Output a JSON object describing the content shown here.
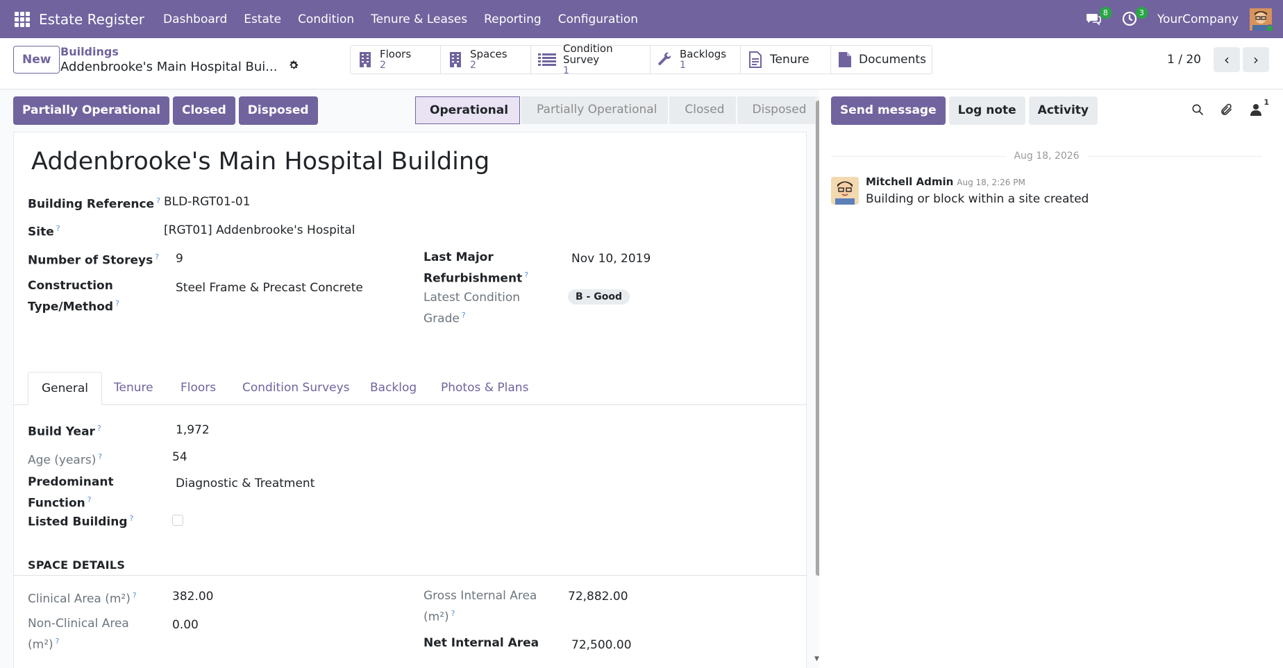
{
  "navbar": {
    "app_title": "Estate Register",
    "menu": [
      "Dashboard",
      "Estate",
      "Condition",
      "Tenure & Leases",
      "Reporting",
      "Configuration"
    ],
    "messages_count": "8",
    "activities_count": "3",
    "company": "YourCompany"
  },
  "control": {
    "new_label": "New",
    "breadcrumb_parent": "Buildings",
    "breadcrumb_current": "Addenbrooke's Main Hospital Bui...",
    "smart_buttons": [
      {
        "label": "Floors",
        "value": "2",
        "icon": "building-icon"
      },
      {
        "label": "Spaces",
        "value": "2",
        "icon": "building-icon"
      },
      {
        "label": "Condition Survey",
        "value": "1",
        "icon": "list-icon"
      },
      {
        "label": "Backlogs",
        "value": "1",
        "icon": "wrench-icon"
      },
      {
        "label": "Tenure",
        "icon": "document-icon"
      },
      {
        "label": "Documents",
        "icon": "file-icon"
      }
    ],
    "pager": "1 / 20"
  },
  "status_actions": [
    "Partially Operational",
    "Closed",
    "Disposed"
  ],
  "statusbar": {
    "stages": [
      "Operational",
      "Partially Operational",
      "Closed",
      "Disposed"
    ],
    "active": "Operational"
  },
  "form": {
    "title": "Addenbrooke's Main Hospital Building",
    "fields": {
      "building_reference": {
        "label": "Building Reference",
        "value": "BLD-RGT01-01"
      },
      "site": {
        "label": "Site",
        "value": "[RGT01] Addenbrooke's Hospital"
      },
      "storeys": {
        "label": "Number of Storeys",
        "value": "9"
      },
      "construction_l1": "Construction",
      "construction_l2": "Type/Method",
      "construction_value": "Steel Frame & Precast Concrete",
      "refurb_l1": "Last Major",
      "refurb_l2": "Refurbishment",
      "refurb_value": "Nov 10, 2019",
      "grade_l1": "Latest Condition",
      "grade_l2": "Grade",
      "grade_value": "B - Good"
    },
    "tabs": [
      "General",
      "Tenure",
      "Floors",
      "Condition Surveys",
      "Backlog",
      "Photos & Plans"
    ],
    "general": {
      "build_year": {
        "label": "Build Year",
        "value": "1,972"
      },
      "age": {
        "label": "Age (years)",
        "value": "54"
      },
      "function_l1": "Predominant",
      "function_l2": "Function",
      "function_value": "Diagnostic & Treatment",
      "listed": {
        "label": "Listed Building"
      }
    },
    "space_details": {
      "title": "SPACE DETAILS",
      "clinical": {
        "label": "Clinical Area (m²)",
        "value": "382.00"
      },
      "nonclinical_l1": "Non-Clinical Area",
      "nonclinical_l2": "(m²)",
      "nonclinical_value": "0.00",
      "gia_l1": "Gross Internal Area",
      "gia_l2": "(m²)",
      "gia_value": "72,882.00",
      "nia_label": "Net Internal Area",
      "nia_value": "72,500.00"
    }
  },
  "chatter": {
    "send_message": "Send message",
    "log_note": "Log note",
    "activity": "Activity",
    "followers_count": "1",
    "date": "Aug 18, 2026",
    "message": {
      "author": "Mitchell Admin",
      "time": "Aug 18, 2:26 PM",
      "body": "Building or block within a site created"
    }
  },
  "colors": {
    "brand": "#71639e",
    "badge": "#28a745"
  }
}
